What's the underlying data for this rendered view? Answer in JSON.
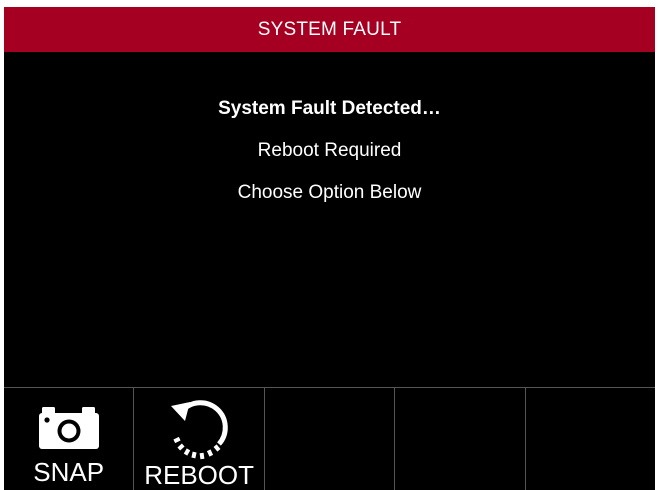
{
  "title_bar": {
    "title": "SYSTEM FAULT",
    "background_color": "#a50021"
  },
  "message": {
    "line1": "System Fault Detected…",
    "line2": "Reboot Required",
    "line3": "Choose Option Below"
  },
  "softkeys": [
    {
      "label": "SNAP",
      "icon": "camera-icon"
    },
    {
      "label": "REBOOT",
      "icon": "reboot-icon"
    },
    {
      "label": "",
      "icon": ""
    },
    {
      "label": "",
      "icon": ""
    },
    {
      "label": "",
      "icon": ""
    }
  ]
}
